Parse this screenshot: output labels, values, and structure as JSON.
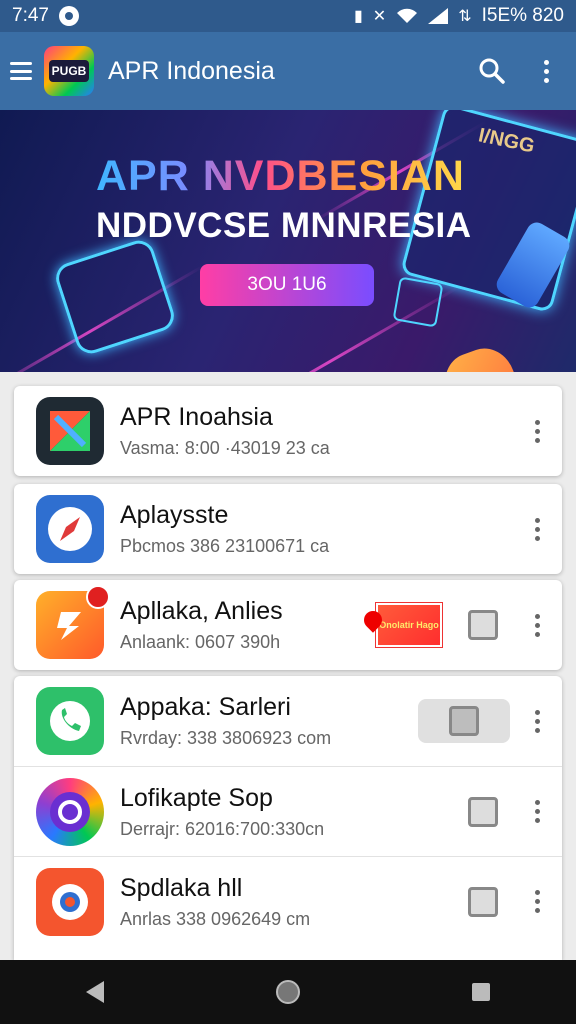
{
  "status_bar": {
    "time": "7:47",
    "battery_text": "I5E% 820"
  },
  "app_bar": {
    "logo_text": "PUGB",
    "title": "APR Indonesia"
  },
  "banner": {
    "title": "APR NVDBESIAN",
    "subtitle": "NDDVCSE MNNRESIA",
    "button_label": "3OU 1U6",
    "device_text": "I/NGG"
  },
  "apps": [
    {
      "name": "APR Inoahsia",
      "meta": "Vasma: 8:00 ·43019 23 ca",
      "icon_color": "#1f2a33",
      "action": "none"
    },
    {
      "name": "Aplaysste",
      "meta": "Pbcmos 386 23100671 ca",
      "icon_color": "#2f6fd0",
      "action": "none"
    },
    {
      "name": "Apllaka, Anlies",
      "meta": "Anlaank: 0607 390h",
      "icon_color": "#ff7a2a",
      "action": "badge",
      "badge_text": "Onolatir Hago"
    },
    {
      "name": "Appaka: Sarleri",
      "meta": "Rvrday: 338 3806923 com",
      "icon_color": "#2ec06a",
      "action": "button-highlight"
    },
    {
      "name": "Lofikapte Sop",
      "meta": "Derrajr: 62016:700:330cn",
      "icon_color": "#8e3fd1",
      "action": "button"
    },
    {
      "name": "Spdlaka hll",
      "meta": "Anrlas 338 0962649 cm",
      "icon_color": "#f4552e",
      "action": "button"
    }
  ]
}
